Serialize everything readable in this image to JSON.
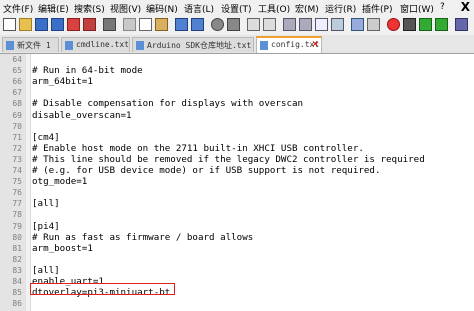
{
  "menu": [
    {
      "label": "文件(F)"
    },
    {
      "label": "编辑(E)"
    },
    {
      "label": "搜索(S)"
    },
    {
      "label": "视图(V)"
    },
    {
      "label": "编码(N)"
    },
    {
      "label": "语言(L)"
    },
    {
      "label": "设置(T)"
    },
    {
      "label": "工具(O)"
    },
    {
      "label": "宏(M)"
    },
    {
      "label": "运行(R)"
    },
    {
      "label": "插件(P)"
    },
    {
      "label": "窗口(W)"
    },
    {
      "label": "?"
    }
  ],
  "close_glyph": "X",
  "tabs": [
    {
      "label": "新文件 1"
    },
    {
      "label": "cmdline.txt"
    },
    {
      "label": "Arduino SDK仓库地址.txt"
    },
    {
      "label": "config.txt"
    }
  ],
  "tab_close_glyph": "✕",
  "lines": [
    {
      "num": "64",
      "text": ""
    },
    {
      "num": "65",
      "text": "# Run in 64-bit mode"
    },
    {
      "num": "66",
      "text": "arm_64bit=1"
    },
    {
      "num": "67",
      "text": ""
    },
    {
      "num": "68",
      "text": "# Disable compensation for displays with overscan"
    },
    {
      "num": "69",
      "text": "disable_overscan=1"
    },
    {
      "num": "70",
      "text": ""
    },
    {
      "num": "71",
      "text": "[cm4]"
    },
    {
      "num": "72",
      "text": "# Enable host mode on the 2711 built-in XHCI USB controller."
    },
    {
      "num": "73",
      "text": "# This line should be removed if the legacy DWC2 controller is required"
    },
    {
      "num": "74",
      "text": "# (e.g. for USB device mode) or if USB support is not required."
    },
    {
      "num": "75",
      "text": "otg_mode=1"
    },
    {
      "num": "76",
      "text": ""
    },
    {
      "num": "77",
      "text": "[all]"
    },
    {
      "num": "78",
      "text": ""
    },
    {
      "num": "79",
      "text": "[pi4]"
    },
    {
      "num": "80",
      "text": "# Run as fast as firmware / board allows"
    },
    {
      "num": "81",
      "text": "arm_boost=1"
    },
    {
      "num": "82",
      "text": ""
    },
    {
      "num": "83",
      "text": "[all]"
    },
    {
      "num": "84",
      "text": "enable_uart=1"
    },
    {
      "num": "85",
      "text": "dtoverlay=pi3-miniuart-bt"
    },
    {
      "num": "86",
      "text": ""
    }
  ]
}
